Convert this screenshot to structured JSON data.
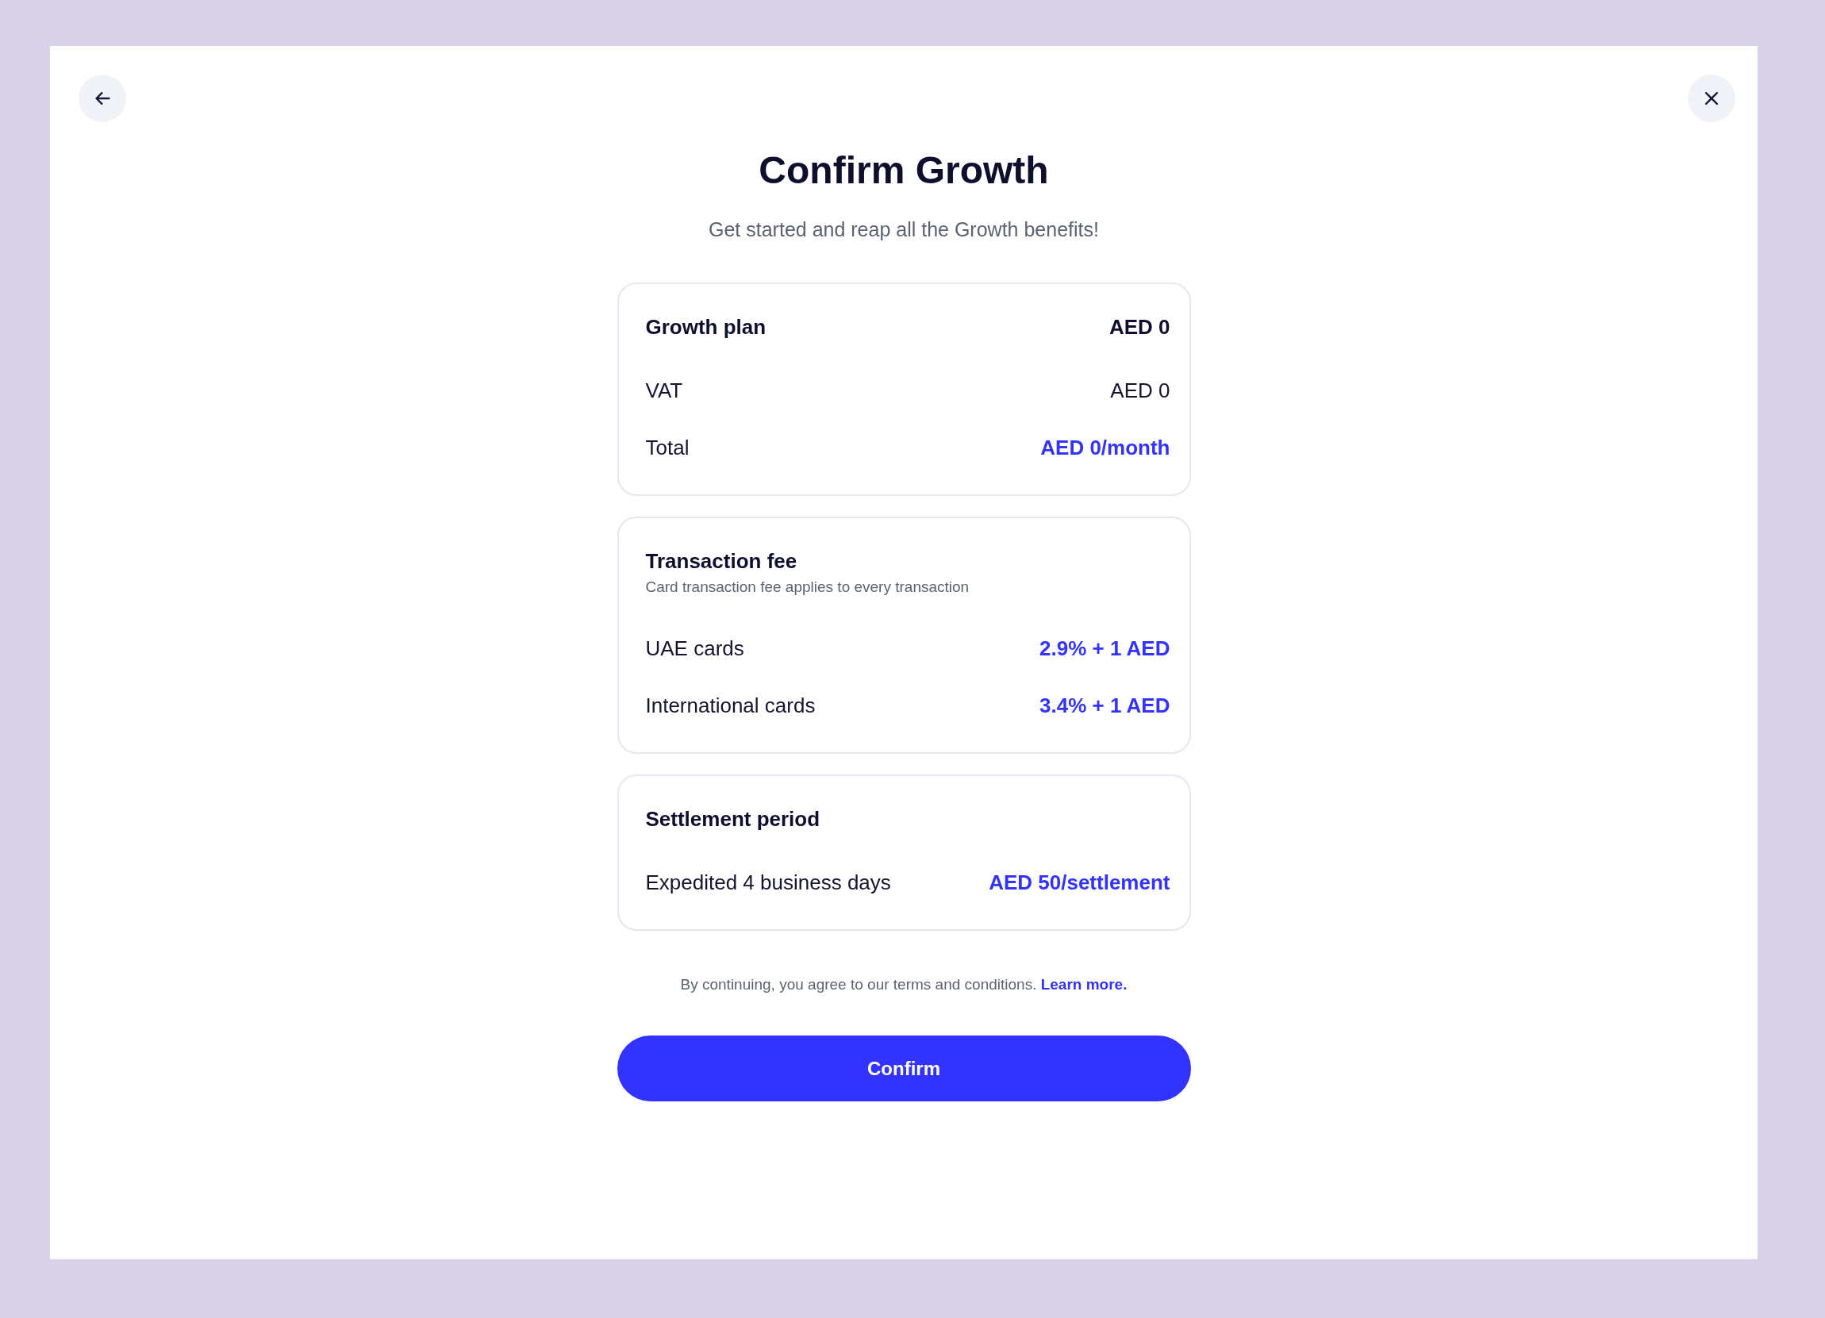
{
  "title": "Confirm Growth",
  "subtitle": "Get started and reap all the Growth benefits!",
  "cards": [
    {
      "heading": {
        "label": "Growth plan",
        "value": "AED 0"
      },
      "rows": [
        {
          "label": "VAT",
          "value": "AED 0",
          "highlighted": false
        },
        {
          "label": "Total",
          "value": "AED 0/month",
          "highlighted": true
        }
      ]
    },
    {
      "heading": {
        "label": "Transaction fee"
      },
      "description": "Card transaction fee applies to every transaction",
      "rows": [
        {
          "label": "UAE cards",
          "value": "2.9% + 1 AED",
          "highlighted": true
        },
        {
          "label": "International cards",
          "value": "3.4% + 1 AED",
          "highlighted": true
        }
      ]
    },
    {
      "heading": {
        "label": "Settlement period"
      },
      "rows": [
        {
          "label": "Expedited 4 business days",
          "value": "AED 50/settlement",
          "highlighted": true
        }
      ]
    }
  ],
  "terms": {
    "text": "By continuing, you agree to our terms and conditions.",
    "link": "Learn more."
  },
  "confirm_button": {
    "label": "Confirm"
  }
}
